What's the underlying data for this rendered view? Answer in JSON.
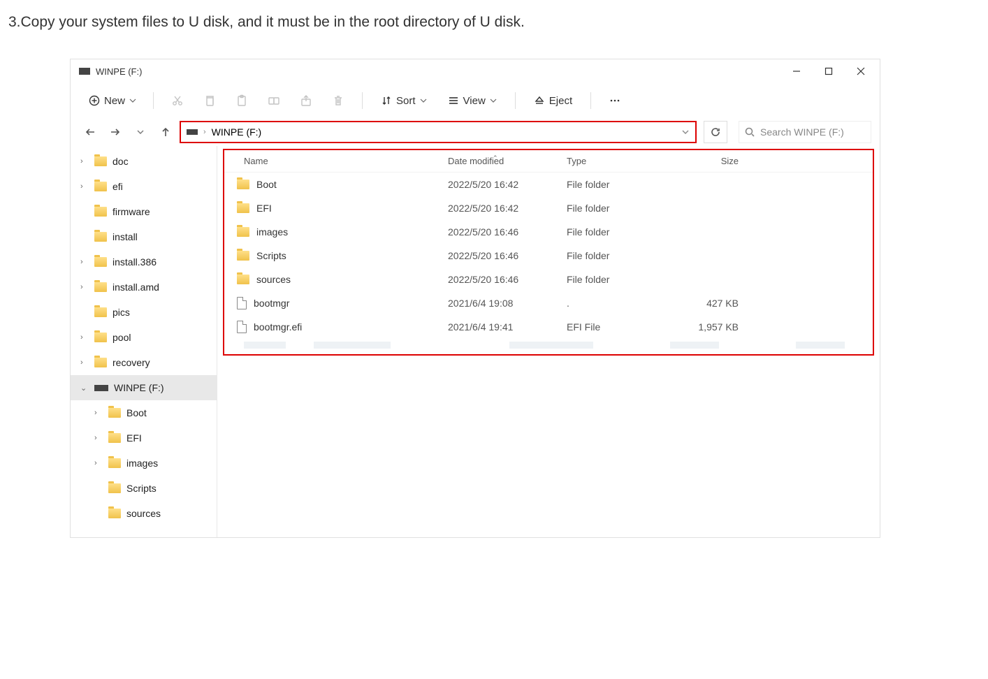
{
  "caption": "3.Copy your system files to U disk, and it must be in the root directory of U disk.",
  "window": {
    "title": "WINPE (F:)"
  },
  "toolbar": {
    "new": "New",
    "sort": "Sort",
    "view": "View",
    "eject": "Eject"
  },
  "address": {
    "path": "WINPE (F:)",
    "search_placeholder": "Search WINPE (F:)"
  },
  "columns": {
    "name": "Name",
    "date": "Date modified",
    "type": "Type",
    "size": "Size"
  },
  "sidebar": {
    "items": [
      {
        "label": "doc",
        "chev": ">",
        "kind": "folder",
        "indent": 0
      },
      {
        "label": "efi",
        "chev": ">",
        "kind": "folder",
        "indent": 0
      },
      {
        "label": "firmware",
        "chev": "",
        "kind": "folder",
        "indent": 0
      },
      {
        "label": "install",
        "chev": "",
        "kind": "folder",
        "indent": 0
      },
      {
        "label": "install.386",
        "chev": ">",
        "kind": "folder",
        "indent": 0
      },
      {
        "label": "install.amd",
        "chev": ">",
        "kind": "folder",
        "indent": 0
      },
      {
        "label": "pics",
        "chev": "",
        "kind": "folder",
        "indent": 0
      },
      {
        "label": "pool",
        "chev": ">",
        "kind": "folder",
        "indent": 0
      },
      {
        "label": "recovery",
        "chev": ">",
        "kind": "folder",
        "indent": 0
      },
      {
        "label": "WINPE (F:)",
        "chev": "v",
        "kind": "usb",
        "indent": 0,
        "selected": true
      },
      {
        "label": "Boot",
        "chev": ">",
        "kind": "folder",
        "indent": 1
      },
      {
        "label": "EFI",
        "chev": ">",
        "kind": "folder",
        "indent": 1
      },
      {
        "label": "images",
        "chev": ">",
        "kind": "folder",
        "indent": 1
      },
      {
        "label": "Scripts",
        "chev": "",
        "kind": "folder",
        "indent": 1
      },
      {
        "label": "sources",
        "chev": "",
        "kind": "folder",
        "indent": 1
      }
    ]
  },
  "files": [
    {
      "name": "Boot",
      "date": "2022/5/20 16:42",
      "type": "File folder",
      "size": "",
      "kind": "folder"
    },
    {
      "name": "EFI",
      "date": "2022/5/20 16:42",
      "type": "File folder",
      "size": "",
      "kind": "folder"
    },
    {
      "name": "images",
      "date": "2022/5/20 16:46",
      "type": "File folder",
      "size": "",
      "kind": "folder"
    },
    {
      "name": "Scripts",
      "date": "2022/5/20 16:46",
      "type": "File folder",
      "size": "",
      "kind": "folder"
    },
    {
      "name": "sources",
      "date": "2022/5/20 16:46",
      "type": "File folder",
      "size": "",
      "kind": "folder"
    },
    {
      "name": "bootmgr",
      "date": "2021/6/4 19:08",
      "type": ".",
      "size": "427 KB",
      "kind": "file"
    },
    {
      "name": "bootmgr.efi",
      "date": "2021/6/4 19:41",
      "type": "EFI File",
      "size": "1,957 KB",
      "kind": "file"
    }
  ]
}
